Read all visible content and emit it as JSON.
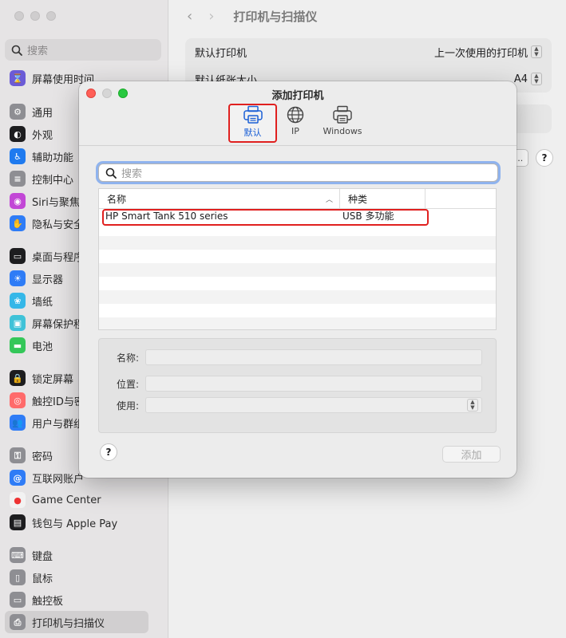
{
  "sidebar": {
    "search_placeholder": "搜索",
    "items": [
      {
        "label": "屏幕使用时间",
        "icon": "hourglass-icon",
        "color": "#6b5bd6",
        "glyph": "⌛"
      },
      {
        "label": "通用",
        "icon": "gear-icon",
        "color": "#8e8e93",
        "glyph": "⚙"
      },
      {
        "label": "外观",
        "icon": "appearance-icon",
        "color": "#1d1d1f",
        "glyph": "◐"
      },
      {
        "label": "辅助功能",
        "icon": "accessibility-icon",
        "color": "#1f7aef",
        "glyph": "♿"
      },
      {
        "label": "控制中心",
        "icon": "control-center-icon",
        "color": "#8e8e93",
        "glyph": "≡"
      },
      {
        "label": "Siri与聚焦",
        "icon": "siri-icon",
        "color": "#c247d6",
        "glyph": "◉"
      },
      {
        "label": "隐私与安全性",
        "icon": "hand-icon",
        "color": "#2f7cf6",
        "glyph": "✋"
      },
      {
        "label": "桌面与程序坞",
        "icon": "dock-icon",
        "color": "#1d1d1f",
        "glyph": "▭"
      },
      {
        "label": "显示器",
        "icon": "display-icon",
        "color": "#2f7cf6",
        "glyph": "☀"
      },
      {
        "label": "墙纸",
        "icon": "wallpaper-icon",
        "color": "#35b7e8",
        "glyph": "❀"
      },
      {
        "label": "屏幕保护程序",
        "icon": "screensaver-icon",
        "color": "#3fc2d8",
        "glyph": "▣"
      },
      {
        "label": "电池",
        "icon": "battery-icon",
        "color": "#34c759",
        "glyph": "▬"
      },
      {
        "label": "锁定屏幕",
        "icon": "lock-icon",
        "color": "#1d1d1f",
        "glyph": "🔒"
      },
      {
        "label": "触控ID与密码",
        "icon": "fingerprint-icon",
        "color": "#ff6b6b",
        "glyph": "◎"
      },
      {
        "label": "用户与群组",
        "icon": "users-icon",
        "color": "#2f7cf6",
        "glyph": "👥"
      },
      {
        "label": "密码",
        "icon": "key-icon",
        "color": "#8e8e93",
        "glyph": "⚿"
      },
      {
        "label": "互联网账户",
        "icon": "at-icon",
        "color": "#2f7cf6",
        "glyph": "@"
      },
      {
        "label": "Game Center",
        "icon": "game-center-icon",
        "color": "#f2f2f2",
        "glyph": "●"
      },
      {
        "label": "钱包与 Apple Pay",
        "icon": "wallet-icon",
        "color": "#1d1d1f",
        "glyph": "▤"
      },
      {
        "label": "键盘",
        "icon": "keyboard-icon",
        "color": "#8e8e93",
        "glyph": "⌨"
      },
      {
        "label": "鼠标",
        "icon": "mouse-icon",
        "color": "#8e8e93",
        "glyph": "▯"
      },
      {
        "label": "触控板",
        "icon": "trackpad-icon",
        "color": "#8e8e93",
        "glyph": "▭"
      },
      {
        "label": "打印机与扫描仪",
        "icon": "printer-icon",
        "color": "#8e8e93",
        "glyph": "⎙"
      }
    ]
  },
  "main": {
    "title": "打印机与扫描仪",
    "default_printer_label": "默认打印机",
    "default_printer_value": "上一次使用的打印机",
    "paper_size_label": "默认纸张大小",
    "paper_size_value": "A4",
    "more_button": "...",
    "help": "?"
  },
  "dialog": {
    "title": "添加打印机",
    "toolbar": [
      {
        "label": "默认",
        "icon": "printer-icon",
        "selected": true
      },
      {
        "label": "IP",
        "icon": "globe-icon",
        "selected": false
      },
      {
        "label": "Windows",
        "icon": "windows-printer-icon",
        "selected": false
      }
    ],
    "search_placeholder": "搜索",
    "table": {
      "col_name": "名称",
      "col_kind": "种类",
      "rows": [
        {
          "name": "HP Smart Tank 510 series",
          "kind": "USB 多功能"
        }
      ]
    },
    "info": {
      "name_label": "名称:",
      "location_label": "位置:",
      "use_label": "使用:"
    },
    "help": "?",
    "add_button": "添加"
  },
  "colors": {
    "highlight": "#e0201f",
    "accent": "#1a5fd6"
  }
}
